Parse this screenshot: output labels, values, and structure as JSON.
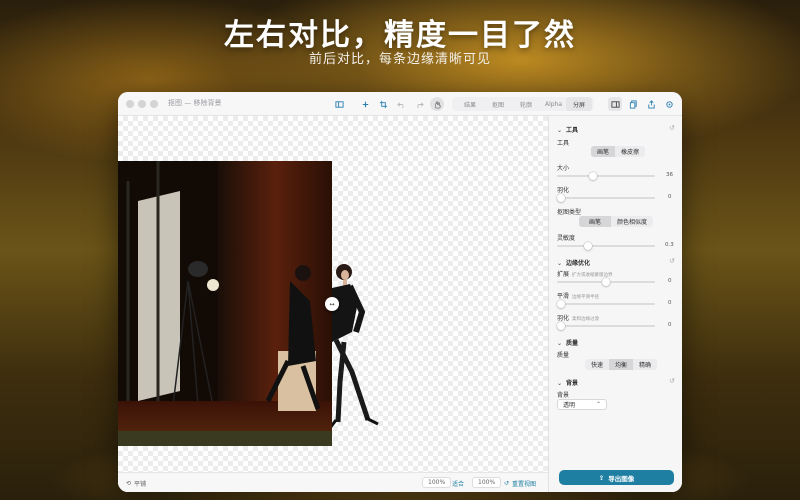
{
  "hero": {
    "title": "左右对比，精度一目了然",
    "subtitle": "前后对比，每条边缘清晰可见"
  },
  "window": {
    "title": "抠图 — 移除背景"
  },
  "toolbar": {
    "tabs": [
      "结果",
      "抠图",
      "轮廓",
      "Alpha",
      "分屏"
    ],
    "active_tab": "分屏",
    "icons": [
      "sidebar-icon",
      "add-icon",
      "crop-icon",
      "undo-icon",
      "redo-icon",
      "select-hand-icon",
      "layout-icon",
      "copy-icon",
      "share-icon",
      "settings-icon"
    ]
  },
  "canvas": {
    "split_handle": "↔"
  },
  "bottombar": {
    "fit_label": "平铺",
    "zoom_left": "100%",
    "fit_button": "适合",
    "zoom_right": "100%",
    "reset_label": "重置视图"
  },
  "panel": {
    "tools": {
      "header": "工具",
      "tool_label": "工具",
      "tool_options": [
        "画笔",
        "橡皮擦"
      ],
      "tool_selected": "画笔",
      "size_label": "大小",
      "size_value": "36",
      "size_fraction": 0.35,
      "feather_label": "羽化",
      "feather_value": "0",
      "feather_fraction": 0.0,
      "matte_label": "抠图类型",
      "matte_options": [
        "画笔",
        "颜色相似度"
      ],
      "matte_selected": "画笔",
      "tolerance_label": "灵敏度",
      "tolerance_value": "0.3",
      "tolerance_fraction": 0.3
    },
    "edge": {
      "header": "边缘优化",
      "expand_label": "扩展",
      "expand_hint": "扩大或收缩蒙版边界",
      "expand_value": "0",
      "expand_fraction": 0.5,
      "smooth_label": "平滑",
      "smooth_hint": "边缘平滑半径",
      "smooth_value": "0",
      "smooth_fraction": 0.0,
      "feather_label": "羽化",
      "feather_hint": "柔和边缘过渡",
      "feather_value": "0",
      "feather_fraction": 0.0
    },
    "quality": {
      "header": "质量",
      "label": "质量",
      "options": [
        "快速",
        "均衡",
        "精确"
      ],
      "selected": "均衡"
    },
    "background": {
      "header": "背景",
      "label": "背景",
      "value": "透明"
    },
    "export_label": "导出图像"
  },
  "colors": {
    "accent": "#1f7fa3",
    "export_button": "#1f7fa3"
  }
}
